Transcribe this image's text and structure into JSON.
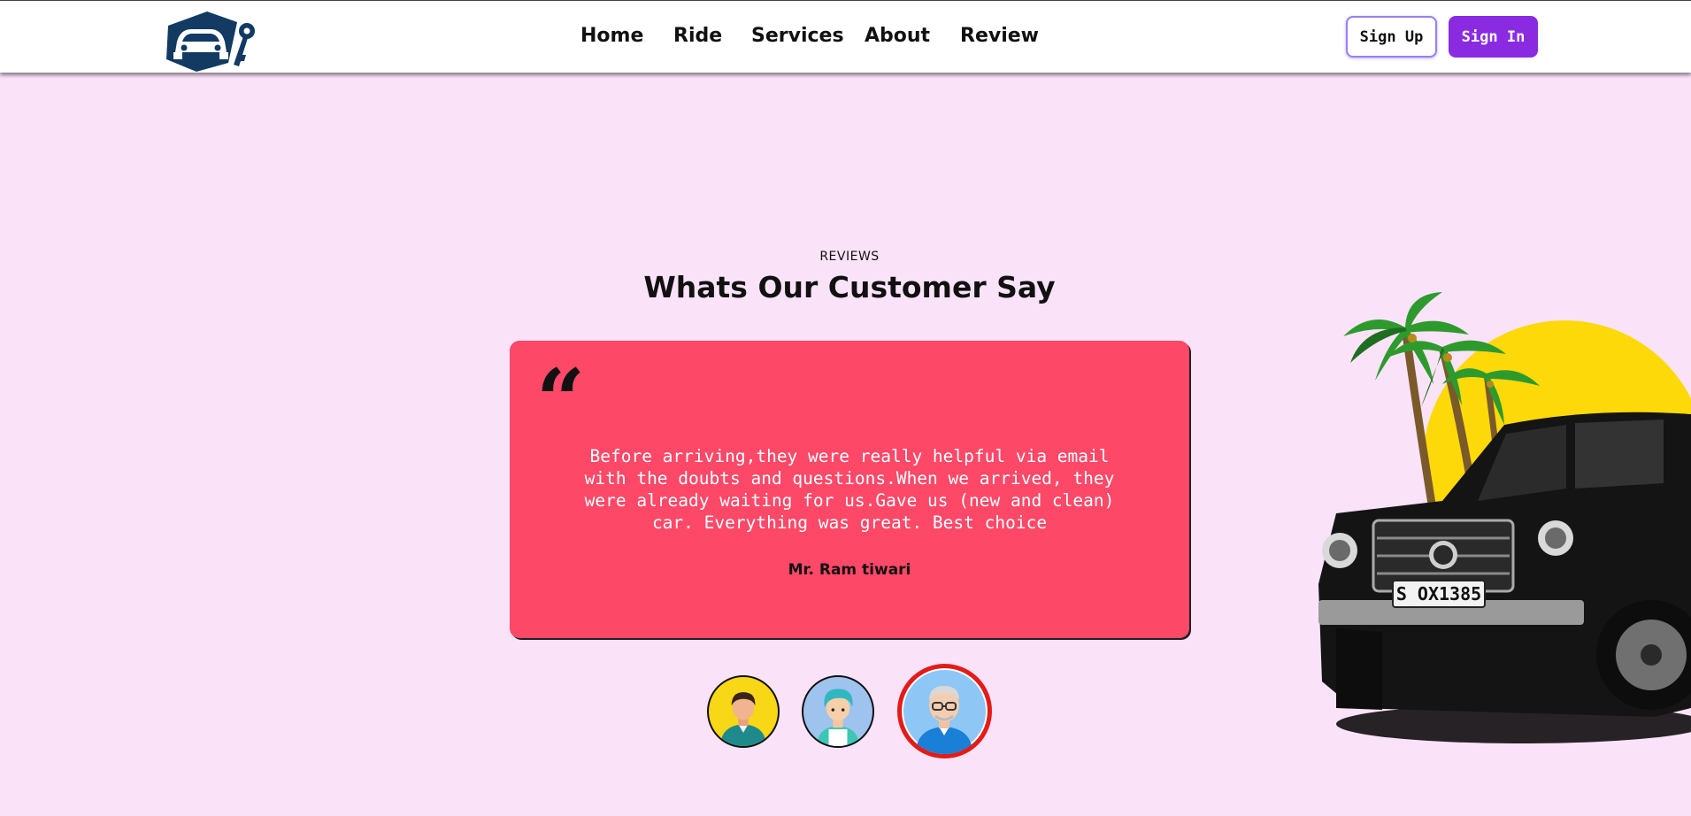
{
  "header": {
    "logo": "car-key-logo",
    "nav": [
      {
        "label": "Home"
      },
      {
        "label": "Ride"
      },
      {
        "label": "Services"
      },
      {
        "label": "About"
      },
      {
        "label": "Review"
      }
    ],
    "sign_up": "Sign Up",
    "sign_in": "Sign In"
  },
  "reviews": {
    "eyebrow": "REVIEWS",
    "title": "Whats Our Customer Say",
    "quote_icon": "quote-icon",
    "text_lines": [
      "Before arriving,they were really helpful via email",
      "with the doubts and questions.When we arrived, they",
      "were already waiting for us.Gave us (new and clean)",
      "car. Everything was great. Best choice"
    ],
    "reviewer": "Mr. Ram tiwari",
    "avatars": [
      {
        "icon": "avatar-man-icon",
        "active": false
      },
      {
        "icon": "avatar-teal-hair-icon",
        "active": false
      },
      {
        "icon": "avatar-old-man-icon",
        "active": true
      }
    ]
  },
  "hero_image": {
    "icon": "suv-palm-trees-illustration",
    "plate": "S OX1385"
  },
  "colors": {
    "background": "#fae3f9",
    "card": "#fd4868",
    "accent": "#8a2be2",
    "active_ring": "#e41b17"
  }
}
